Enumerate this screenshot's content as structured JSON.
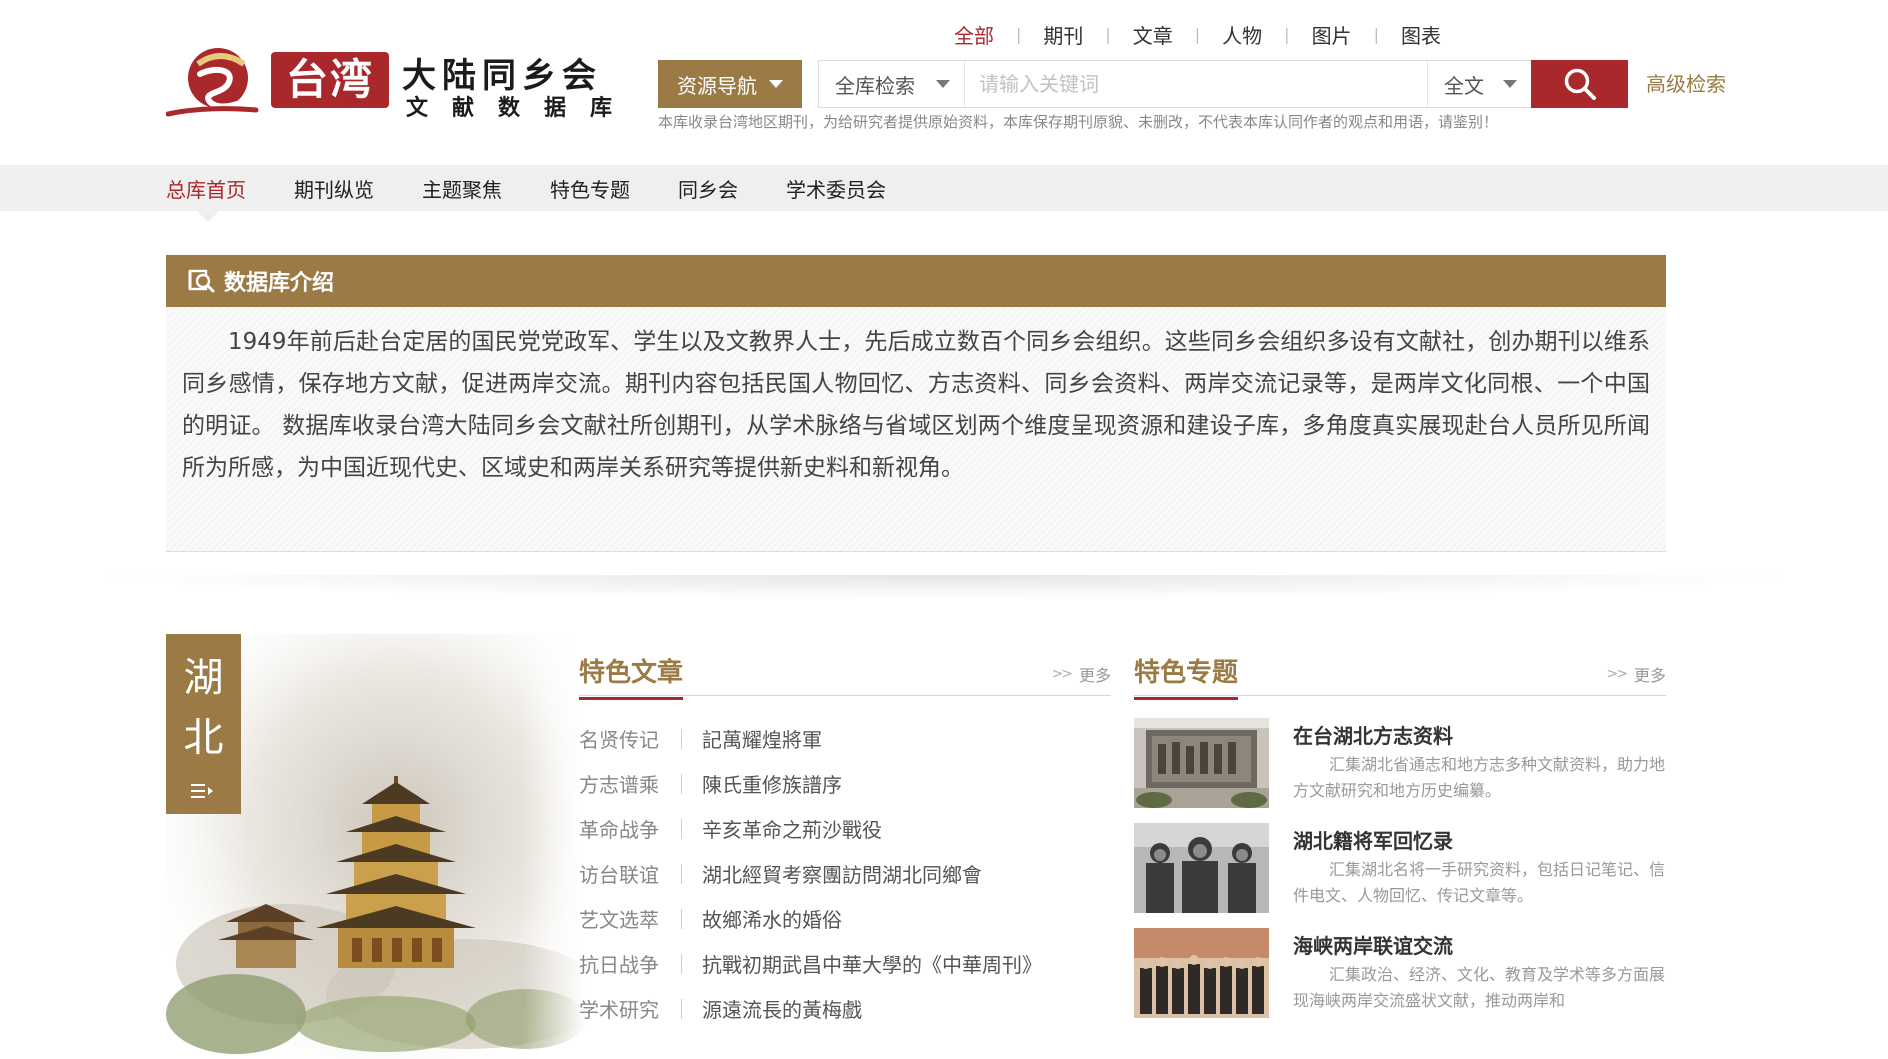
{
  "brand": {
    "logo_tw": "台湾",
    "title": "大陆同乡会",
    "subtitle": "文献数据库"
  },
  "search": {
    "scope_tabs": [
      {
        "label": "全部",
        "active": true
      },
      {
        "label": "期刊",
        "active": false
      },
      {
        "label": "文章",
        "active": false
      },
      {
        "label": "人物",
        "active": false
      },
      {
        "label": "图片",
        "active": false
      },
      {
        "label": "图表",
        "active": false
      }
    ],
    "resource_nav_label": "资源导航",
    "scope_select_value": "全库检索",
    "placeholder": "请输入关键词",
    "field_select_value": "全文",
    "advanced_label": "高级检索",
    "notice": "本库收录台湾地区期刊，为给研究者提供原始资料，本库保存期刊原貌、未删改，不代表本库认同作者的观点和用语，请鉴别！"
  },
  "nav": {
    "items": [
      {
        "label": "总库首页",
        "active": true
      },
      {
        "label": "期刊纵览",
        "active": false
      },
      {
        "label": "主题聚焦",
        "active": false
      },
      {
        "label": "特色专题",
        "active": false
      },
      {
        "label": "同乡会",
        "active": false
      },
      {
        "label": "学术委员会",
        "active": false
      }
    ]
  },
  "intro": {
    "title": "数据库介绍",
    "text": "1949年前后赴台定居的国民党党政军、学生以及文教界人士，先后成立数百个同乡会组织。这些同乡会组织多设有文献社，创办期刊以维系同乡感情，保存地方文献，促进两岸交流。期刊内容包括民国人物回忆、方志资料、同乡会资料、两岸交流记录等，是两岸文化同根、一个中国的明证。 数据库收录台湾大陆同乡会文献社所创期刊，从学术脉络与省域区划两个维度呈现资源和建设子库，多角度真实展现赴台人员所见所闻所为所感，为中国近现代史、区域史和两岸关系研究等提供新史料和新视角。"
  },
  "region": {
    "char1": "湖",
    "char2": "北"
  },
  "featured_articles": {
    "title": "特色文章",
    "more": "更多",
    "items": [
      {
        "category": "名贤传记",
        "title": "記萬耀煌將軍"
      },
      {
        "category": "方志谱乘",
        "title": "陳氏重修族譜序"
      },
      {
        "category": "革命战争",
        "title": "辛亥革命之荊沙戰役"
      },
      {
        "category": "访台联谊",
        "title": "湖北經貿考察團訪問湖北同鄉會"
      },
      {
        "category": "艺文选萃",
        "title": "故鄉浠水的婚俗"
      },
      {
        "category": "抗日战争",
        "title": "抗戰初期武昌中華大學的《中華周刊》"
      },
      {
        "category": "学术研究",
        "title": "源遠流長的黃梅戲"
      }
    ]
  },
  "featured_topics": {
    "title": "特色专题",
    "more": "更多",
    "items": [
      {
        "title": "在台湖北方志资料",
        "desc": "汇集湖北省通志和地方志多种文献资料，助力地方文献研究和地方历史编纂。"
      },
      {
        "title": "湖北籍将军回忆录",
        "desc": "汇集湖北名将一手研究资料，包括日记笔记、信件电文、人物回忆、传记文章等。"
      },
      {
        "title": "海峡两岸联谊交流",
        "desc": "汇集政治、经济、文化、教育及学术等多方面展现海峡两岸交流盛状文献，推动两岸和"
      }
    ]
  },
  "colors": {
    "accent_brown": "#9b7a45",
    "accent_red": "#a8282c",
    "nav_bg": "#efefef"
  }
}
